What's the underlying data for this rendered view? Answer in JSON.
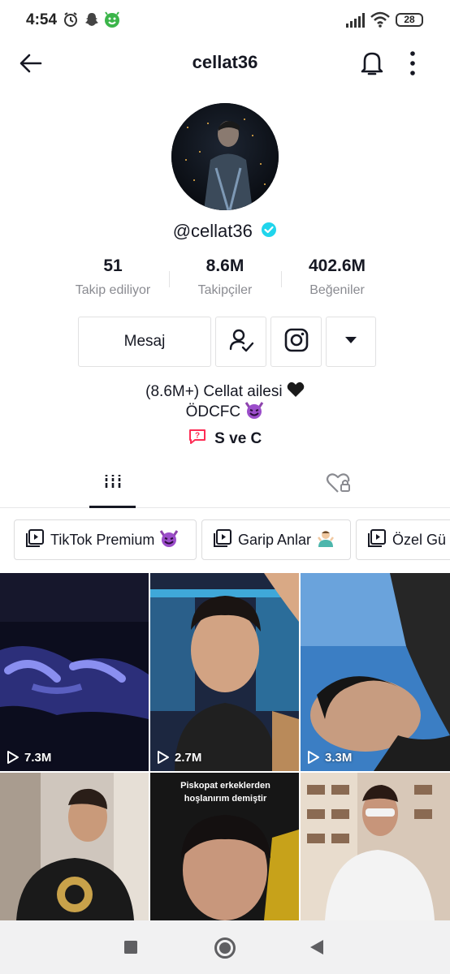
{
  "status_bar": {
    "time": "4:54",
    "battery": "28",
    "icons": [
      "alarm-icon",
      "snapchat-icon",
      "notification-app-icon",
      "signal-icon",
      "wifi-icon",
      "battery-icon"
    ]
  },
  "header": {
    "title": "cellat36",
    "icons": [
      "back-arrow-icon",
      "bell-icon",
      "more-vertical-icon"
    ]
  },
  "profile": {
    "username": "@cellat36",
    "verified": true,
    "verified_color": "#20d5ec",
    "stats": [
      {
        "value": "51",
        "label": "Takip ediliyor"
      },
      {
        "value": "8.6M",
        "label": "Takipçiler"
      },
      {
        "value": "402.6M",
        "label": "Beğeniler"
      }
    ],
    "message_label": "Mesaj",
    "action_icons": [
      "following-check-icon",
      "instagram-icon",
      "dropdown-triangle-icon"
    ],
    "bio_line1": "(8.6M+) Cellat ailesi",
    "bio_line1_emoji": "black-heart",
    "bio_line2": "ÖDCFC",
    "bio_line2_emoji": "smiling-devil",
    "bio_link_label": "S ve C",
    "bio_link_color": "#fe2c55"
  },
  "tabs": [
    {
      "name": "videos",
      "icon": "grid-icon",
      "active": true
    },
    {
      "name": "liked",
      "icon": "heart-lock-icon",
      "active": false
    }
  ],
  "playlists": [
    {
      "label": "TikTok Premium",
      "emoji": "smiling-devil"
    },
    {
      "label": "Garip Anlar",
      "emoji": "person-shrugging"
    },
    {
      "label": "Özel Gü",
      "emoji": ""
    }
  ],
  "videos": [
    {
      "views": "7.3M",
      "caption": ""
    },
    {
      "views": "2.7M",
      "caption": ""
    },
    {
      "views": "3.3M",
      "caption": ""
    },
    {
      "views": "",
      "caption": ""
    },
    {
      "views": "",
      "caption_line1": "Piskopat erkeklerden",
      "caption_line2": "hoşlanırım demiştir"
    },
    {
      "views": "",
      "caption": ""
    }
  ],
  "nav_bar": {
    "icons": [
      "recents-square-icon",
      "home-circle-icon",
      "back-triangle-icon"
    ],
    "background": "#f1f1f2"
  }
}
